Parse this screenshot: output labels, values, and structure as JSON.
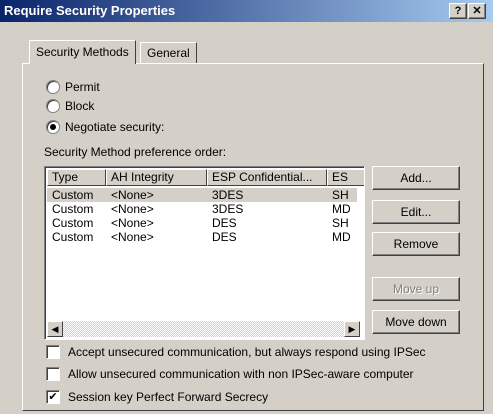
{
  "window": {
    "title": "Require Security Properties",
    "help_glyph": "?",
    "close_glyph": "✕"
  },
  "tabs": [
    {
      "label": "Security Methods",
      "active": true
    },
    {
      "label": "General",
      "active": false
    }
  ],
  "radios": [
    {
      "label": "Permit",
      "checked": false
    },
    {
      "label": "Block",
      "checked": false
    },
    {
      "label": "Negotiate security:",
      "checked": true
    }
  ],
  "list": {
    "label": "Security Method preference order:",
    "columns": [
      "Type",
      "AH Integrity",
      "ESP Confidential...",
      "ES"
    ],
    "rows": [
      [
        "Custom",
        "<None>",
        "3DES",
        "SH"
      ],
      [
        "Custom",
        "<None>",
        "3DES",
        "MD"
      ],
      [
        "Custom",
        "<None>",
        "DES",
        "SH"
      ],
      [
        "Custom",
        "<None>",
        "DES",
        "MD"
      ]
    ],
    "scroll_left": "◀",
    "scroll_right": "▶"
  },
  "buttons": {
    "add": "Add...",
    "edit": "Edit...",
    "remove": "Remove",
    "move_up": "Move up",
    "move_down": "Move down"
  },
  "checkboxes": [
    {
      "label": "Accept unsecured communication, but always respond using IPSec",
      "checked": false
    },
    {
      "label": "Allow unsecured communication with non IPSec-aware computer",
      "checked": false
    },
    {
      "label": "Session key Perfect Forward Secrecy",
      "checked": true
    }
  ],
  "check_glyph": "✔"
}
